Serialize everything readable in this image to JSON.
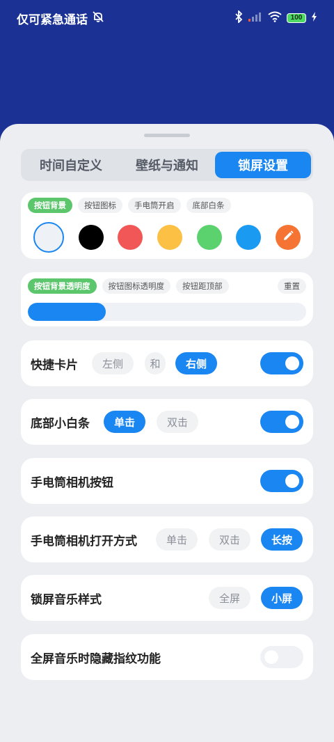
{
  "status": {
    "carrier_text": "仅可紧急通话",
    "battery": "100"
  },
  "tabs": [
    {
      "label": "时间自定义"
    },
    {
      "label": "壁纸与通知"
    },
    {
      "label": "锁屏设置"
    }
  ],
  "button_bg_card": {
    "chips": [
      "按钮背景",
      "按钮图标",
      "手电筒开启",
      "底部白条"
    ],
    "swatch_colors": [
      "#eef2f7",
      "#000000",
      "#f25757",
      "#fcc044",
      "#5cd26e",
      "#1a9bf1",
      "#f57434"
    ],
    "selected_index": 0
  },
  "opacity_card": {
    "chips": [
      "按钮背景透明度",
      "按钮图标透明度",
      "按钮距顶部"
    ],
    "reset_label": "重置",
    "slider_value": 0.28
  },
  "quick_card": {
    "label": "快捷卡片",
    "left": "左侧",
    "and": "和",
    "right": "右侧",
    "toggle_on": true
  },
  "bottom_bar": {
    "label": "底部小白条",
    "single": "单击",
    "double": "双击",
    "toggle_on": true
  },
  "flashlight_btn": {
    "label": "手电筒相机按钮",
    "toggle_on": true
  },
  "flashlight_open": {
    "label": "手电筒相机打开方式",
    "single": "单击",
    "double": "双击",
    "long": "长按"
  },
  "music_style": {
    "label": "锁屏音乐样式",
    "full": "全屏",
    "small": "小屏"
  },
  "hide_fingerprint": {
    "label": "全屏音乐时隐藏指纹功能",
    "toggle_on": false
  },
  "colors": {
    "accent": "#1a86f1",
    "header_bg": "#1b3294",
    "chip_green": "#5cc66c"
  }
}
